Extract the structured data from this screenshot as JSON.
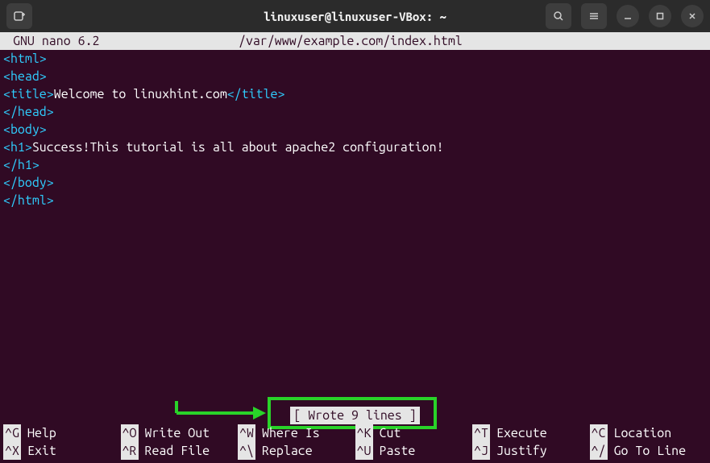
{
  "window": {
    "title": "linuxuser@linuxuser-VBox: ~"
  },
  "nano": {
    "app_name": "GNU nano 6.2",
    "file_path": "/var/www/example.com/index.html",
    "status_message": "[ Wrote 9 lines ]"
  },
  "code_lines": [
    {
      "type": "tag",
      "text": "<html>"
    },
    {
      "type": "tag",
      "text": "<head>"
    },
    {
      "type": "mixed",
      "segments": [
        {
          "c": "tag",
          "t": "<title>"
        },
        {
          "c": "txt",
          "t": "Welcome to linuxhint.com"
        },
        {
          "c": "tag",
          "t": "</title>"
        }
      ]
    },
    {
      "type": "tag",
      "text": "</head>"
    },
    {
      "type": "tag",
      "text": "<body>"
    },
    {
      "type": "mixed",
      "segments": [
        {
          "c": "tag",
          "t": "<h1>"
        },
        {
          "c": "txt",
          "t": "Success!This tutorial is all about apache2 configuration!"
        }
      ]
    },
    {
      "type": "tag",
      "text": "</h1>"
    },
    {
      "type": "tag",
      "text": "</body>"
    },
    {
      "type": "tag",
      "text": "</html>"
    }
  ],
  "shortcuts": [
    {
      "key": "^G",
      "label": "Help"
    },
    {
      "key": "^X",
      "label": "Exit"
    },
    {
      "key": "^O",
      "label": "Write Out"
    },
    {
      "key": "^R",
      "label": "Read File"
    },
    {
      "key": "^W",
      "label": "Where Is"
    },
    {
      "key": "^\\",
      "label": "Replace"
    },
    {
      "key": "^K",
      "label": "Cut"
    },
    {
      "key": "^U",
      "label": "Paste"
    },
    {
      "key": "^T",
      "label": "Execute"
    },
    {
      "key": "^J",
      "label": "Justify"
    },
    {
      "key": "^C",
      "label": "Location"
    },
    {
      "key": "^/",
      "label": "Go To Line"
    }
  ]
}
